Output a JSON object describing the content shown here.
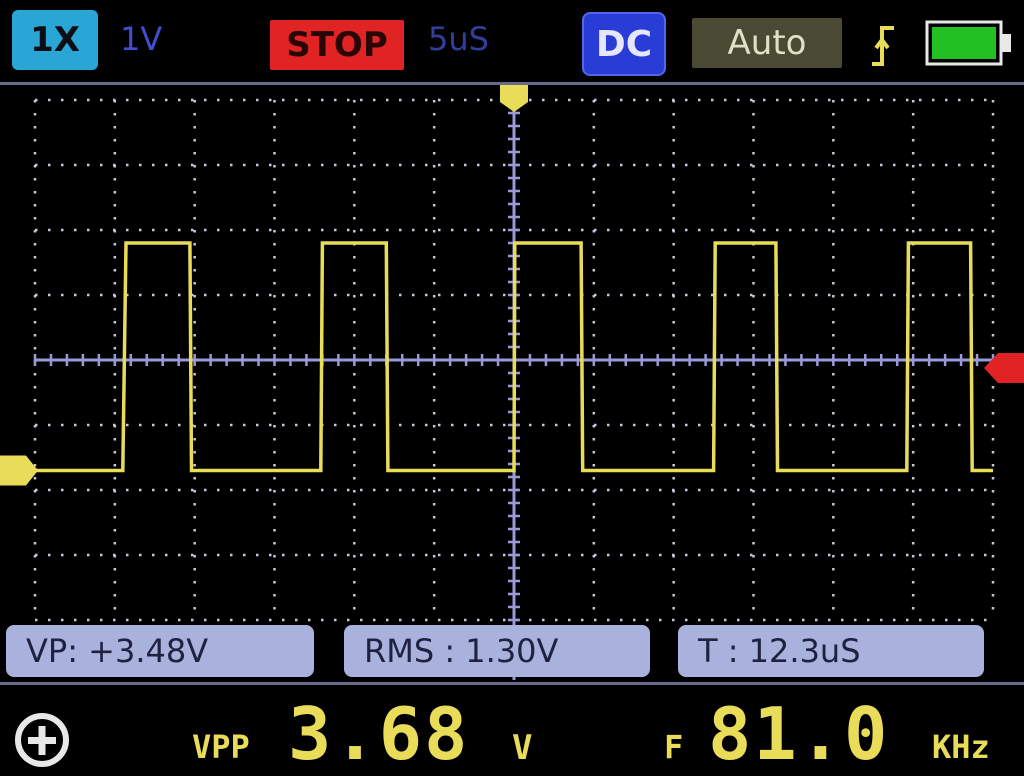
{
  "header": {
    "probe": "1X",
    "volts_per_div": "1V",
    "run_state": "STOP",
    "time_per_div": "5uS",
    "coupling": "DC",
    "trigger_mode": "Auto",
    "trigger_edge_icon": "rising-edge-icon",
    "battery_icon": "battery-icon",
    "battery_level": 1.0
  },
  "colors": {
    "trace": "#e8dc58",
    "grid": "#c8c8dc",
    "axis": "#9a9ad8",
    "stop": "#e02424",
    "coupling": "#2a3cd6",
    "probe": "#29a6d6",
    "battery": "#22c022",
    "trigger_level": "#e02424"
  },
  "measurements": {
    "vp": "VP: +3.48V",
    "rms": "RMS : 1.30V",
    "period": "T : 12.3uS"
  },
  "readout": {
    "vpp_label": "VPP",
    "vpp_value": "3.68",
    "vpp_unit": "V",
    "f_label": "F",
    "f_value": "81.0",
    "f_unit": "KHz"
  },
  "footer": {
    "cursor_icon": "plus-circle-icon"
  },
  "chart_data": {
    "type": "line",
    "waveform": "square",
    "x_unit": "us",
    "y_unit": "V",
    "xlim": [
      -30,
      30
    ],
    "ylim": [
      -4,
      4
    ],
    "x_divisions": 12,
    "y_divisions": 8,
    "grid": true,
    "series": [
      {
        "x": [
          -30.0,
          -24.5,
          -24.3,
          -20.3,
          -20.2,
          -12.1,
          -12.0,
          -8.0,
          -7.9,
          0.0,
          0.05,
          4.2,
          4.3,
          12.5,
          12.6,
          16.4,
          16.5,
          24.6,
          24.7,
          28.6,
          28.7,
          30.0
        ],
        "y": [
          -1.7,
          -1.7,
          1.8,
          1.8,
          -1.7,
          -1.7,
          1.8,
          1.8,
          -1.7,
          -1.7,
          1.8,
          1.8,
          -1.7,
          -1.7,
          1.8,
          1.8,
          -1.7,
          -1.7,
          1.8,
          1.8,
          -1.7,
          -1.7
        ]
      }
    ],
    "trigger_level": 0.0,
    "ground_level": -1.7
  }
}
